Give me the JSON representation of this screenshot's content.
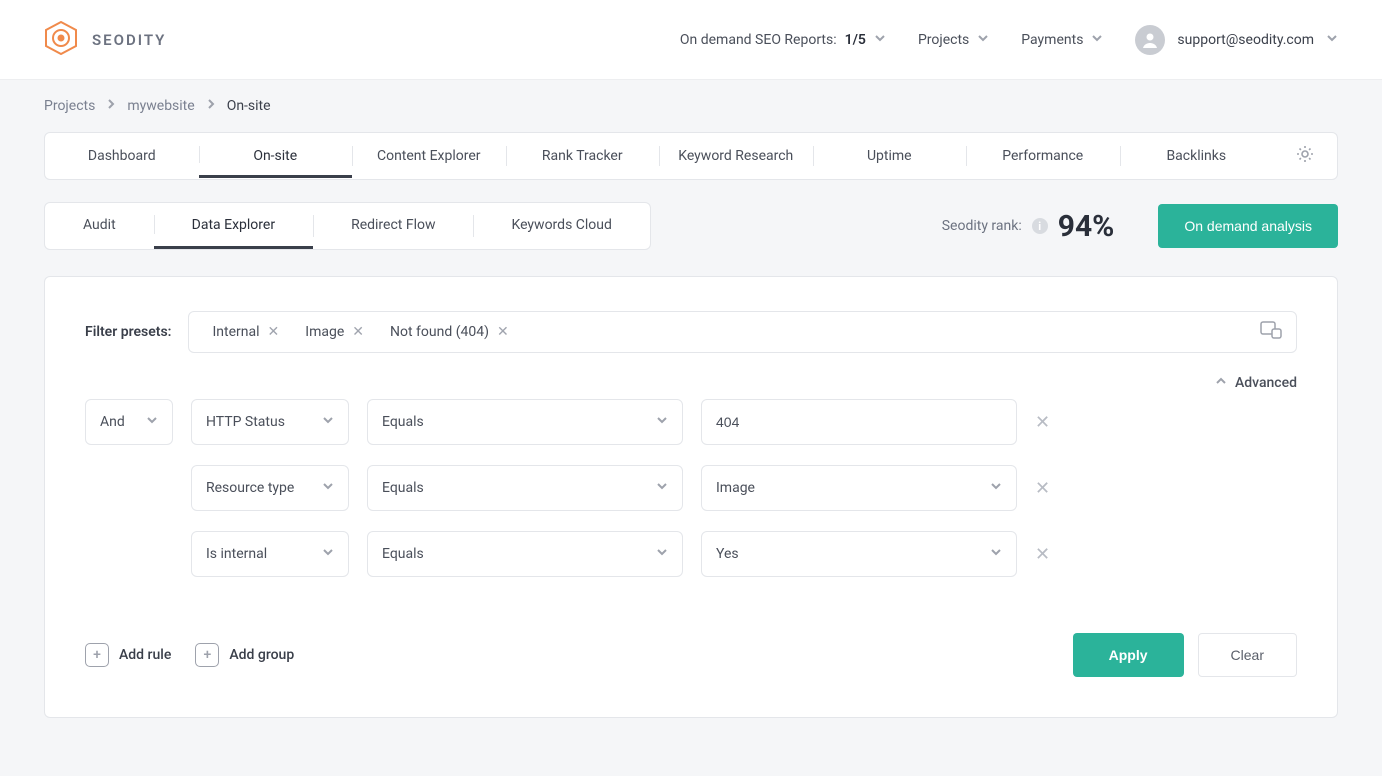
{
  "brand": {
    "name": "SEODITY"
  },
  "header": {
    "reports_label": "On demand SEO Reports:",
    "reports_count": "1/5",
    "projects_label": "Projects",
    "payments_label": "Payments",
    "user_email": "support@seodity.com"
  },
  "breadcrumb": {
    "items": [
      "Projects",
      "mywebsite",
      "On-site"
    ]
  },
  "tabs": {
    "main": [
      "Dashboard",
      "On-site",
      "Content Explorer",
      "Rank Tracker",
      "Keyword Research",
      "Uptime",
      "Performance",
      "Backlinks"
    ],
    "main_active_index": 1,
    "sub": [
      "Audit",
      "Data Explorer",
      "Redirect Flow",
      "Keywords Cloud"
    ],
    "sub_active_index": 1
  },
  "rank": {
    "label": "Seodity rank:",
    "value": "94%"
  },
  "buttons": {
    "on_demand": "On demand analysis",
    "apply": "Apply",
    "clear": "Clear",
    "add_rule": "Add rule",
    "add_group": "Add group",
    "advanced": "Advanced"
  },
  "filter": {
    "presets_label": "Filter presets:",
    "chips": [
      "Internal",
      "Image",
      "Not found (404)"
    ],
    "rules": [
      {
        "logic": "And",
        "field": "HTTP Status",
        "operator": "Equals",
        "value": "404",
        "value_type": "text"
      },
      {
        "logic": "",
        "field": "Resource type",
        "operator": "Equals",
        "value": "Image",
        "value_type": "select"
      },
      {
        "logic": "",
        "field": "Is internal",
        "operator": "Equals",
        "value": "Yes",
        "value_type": "select"
      }
    ]
  }
}
